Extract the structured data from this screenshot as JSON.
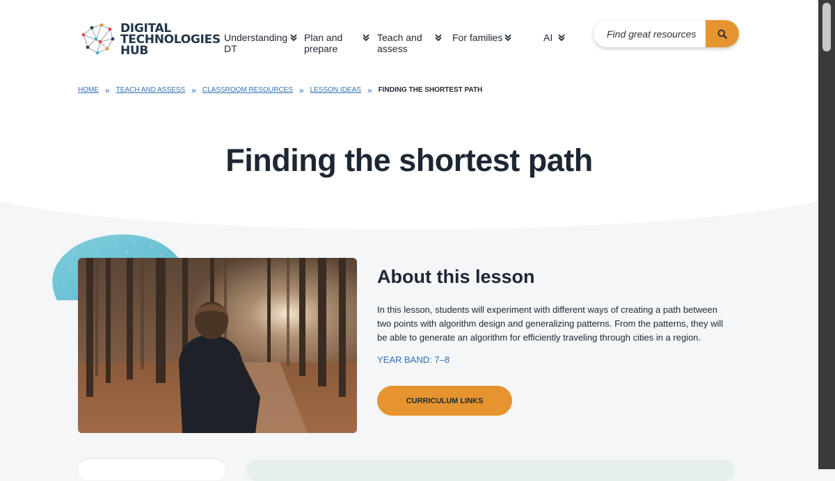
{
  "logo": {
    "lines": [
      "DIGITAL",
      "TECHNOLOGIES",
      "HUB"
    ],
    "icon": "network-dots-icon"
  },
  "nav": [
    {
      "line1": "Understanding",
      "line2": "DT",
      "icon": "chevron-double-down-icon"
    },
    {
      "line1": "Plan and",
      "line2": "prepare",
      "icon": "chevron-double-down-icon"
    },
    {
      "line1": "Teach and",
      "line2": "assess",
      "icon": "chevron-double-down-icon"
    },
    {
      "line1": "For families",
      "line2": "",
      "icon": "chevron-double-down-icon"
    },
    {
      "line1": "AI",
      "line2": "",
      "icon": "chevron-double-down-icon"
    }
  ],
  "search": {
    "placeholder": "Find great resources",
    "icon": "search-icon"
  },
  "breadcrumb": {
    "items": [
      "HOME",
      "TEACH AND ASSESS",
      "CLASSROOM RESOURCES",
      "LESSON IDEAS"
    ],
    "current": "FINDING THE SHORTEST PATH",
    "separator_icon": "double-chevron-right-icon"
  },
  "page": {
    "title": "Finding the shortest path"
  },
  "lesson": {
    "heading": "About this lesson",
    "description": "In this lesson, students will experiment with different ways of creating a path between two points with algorithm design and generalizing patterns. From the patterns, they will be able to generate an algorithm for efficiently traveling through cities in a region.",
    "year_band": "YEAR BAND: 7–8",
    "curriculum_button": "CURRICULUM LINKS"
  },
  "colors": {
    "accent": "#e5942f",
    "link": "#2f6fb5",
    "text": "#1d2733",
    "blob": "#6bc3d6"
  }
}
